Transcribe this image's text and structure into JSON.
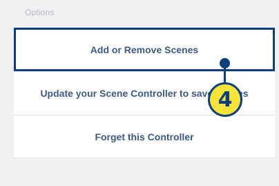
{
  "options": {
    "header": "Options",
    "items": [
      {
        "label": "Add or Remove Scenes"
      },
      {
        "label": "Update your Scene Controller to save scenes"
      },
      {
        "label": "Forget this Controller"
      }
    ]
  },
  "callout": {
    "number": "4",
    "color": "#0e3f7d",
    "badge_color": "#f6e43c"
  }
}
